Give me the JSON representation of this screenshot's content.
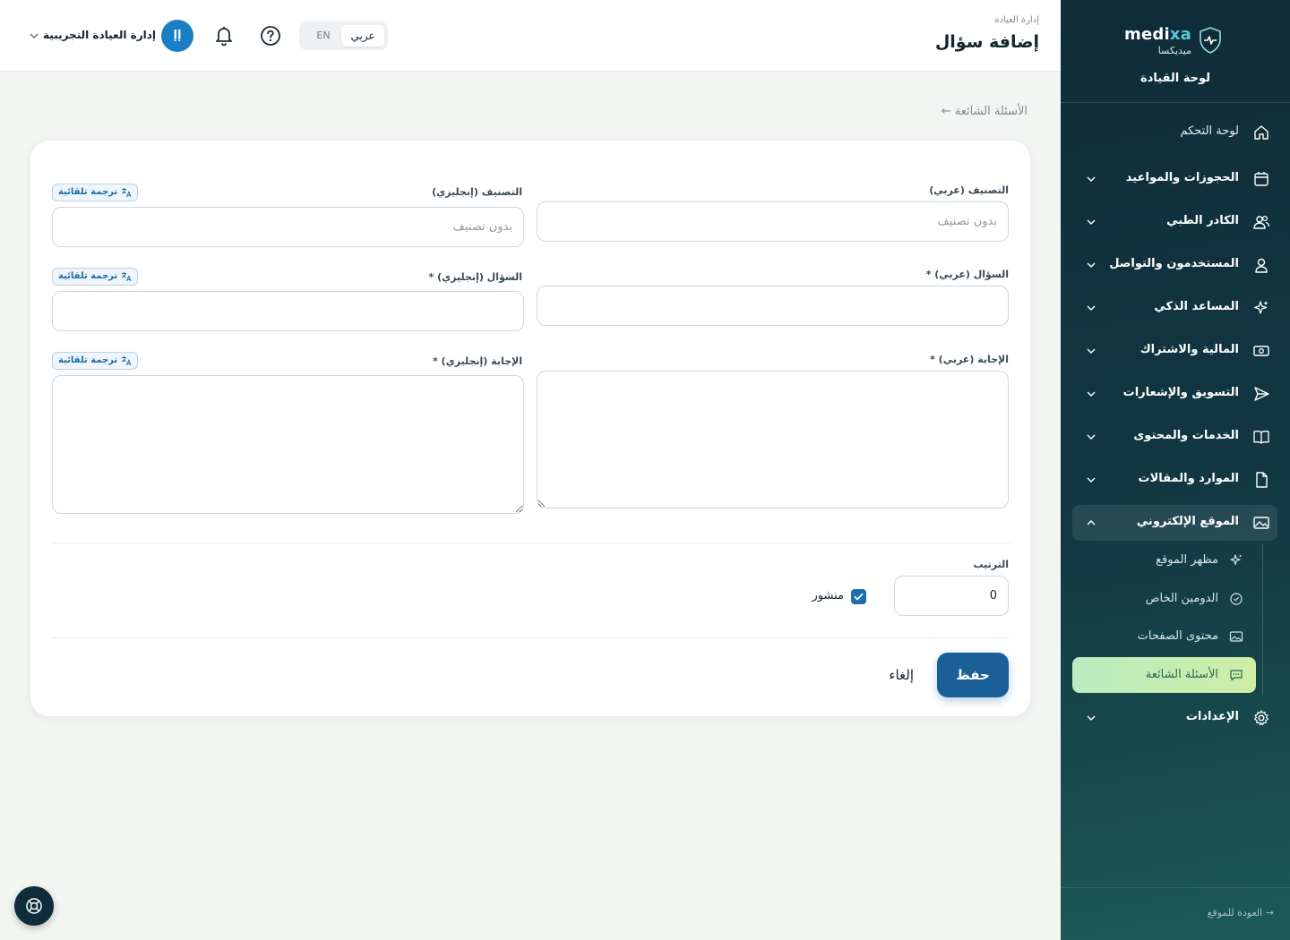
{
  "sidebar": {
    "brand_name_main": "medi",
    "brand_name_accent": "xa",
    "brand_subtitle": "ميديكسا",
    "dashboard_title": "لوحة القيادة",
    "items": [
      {
        "label": "لوحة التحكم",
        "icon": "home-icon",
        "expandable": false
      },
      {
        "label": "الحجوزات والمواعيد",
        "icon": "calendar-icon",
        "expandable": true
      },
      {
        "label": "الكادر الطبي",
        "icon": "users-icon",
        "expandable": true
      },
      {
        "label": "المستخدمون والتواصل",
        "icon": "user-icon",
        "expandable": true
      },
      {
        "label": "المساعد الذكي",
        "icon": "sparkles-icon",
        "expandable": true
      },
      {
        "label": "المالية والاشتراك",
        "icon": "money-icon",
        "expandable": true
      },
      {
        "label": "التسويق والإشعارات",
        "icon": "send-icon",
        "expandable": true
      },
      {
        "label": "الخدمات والمحتوى",
        "icon": "book-icon",
        "expandable": true
      },
      {
        "label": "الموارد والمقالات",
        "icon": "file-icon",
        "expandable": true
      },
      {
        "label": "الموقع الإلكتروني",
        "icon": "image-icon",
        "expandable": true,
        "expanded": true
      },
      {
        "label": "الإعدادات",
        "icon": "gear-icon",
        "expandable": true
      }
    ],
    "website_subitems": [
      {
        "label": "مظهر الموقع",
        "icon": "sparkle-icon"
      },
      {
        "label": "الدومين الخاص",
        "icon": "check-circle-icon"
      },
      {
        "label": "محتوى الصفحات",
        "icon": "image-icon"
      },
      {
        "label": "الأسئلة الشائعة",
        "icon": "chat-icon",
        "active": true
      }
    ],
    "back_to_site": "العودة للموقع"
  },
  "header": {
    "breadcrumb": "إدارة العيادة",
    "title": "إضافة سؤال",
    "lang_en": "EN",
    "lang_ar": "عربي",
    "user_initials": "إإ",
    "user_name": "إدارة العيادة التجريبية"
  },
  "main": {
    "back_link": "← الأسئلة الشائعة",
    "form": {
      "category_ar_label": "التصنيف (عربي)",
      "category_ar_placeholder": "بدون تصنيف",
      "category_en_label": "التصنيف (إنجليزي)",
      "category_en_placeholder": "بدون تصنيف",
      "question_ar_label": "السؤال (عربي) *",
      "question_en_label": "السؤال (إنجليزي) *",
      "answer_ar_label": "الإجابة (عربي) *",
      "answer_en_label": "الإجابة (إنجليزي) *",
      "auto_translate": "ترجمة تلقائية",
      "order_label": "الترتيب",
      "order_value": "0",
      "published_label": "منشور",
      "published_checked": true,
      "save_label": "حفظ",
      "cancel_label": "إلغاء"
    }
  },
  "colors": {
    "accent": "#1b5f99",
    "sidebar_bg": "#123843",
    "active_item": "#c6edb3"
  }
}
